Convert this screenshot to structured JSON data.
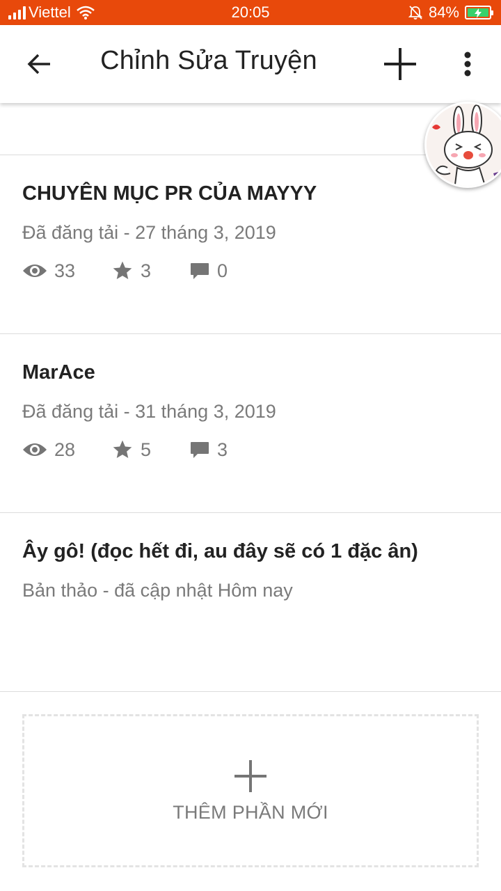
{
  "status_bar": {
    "carrier": "Viettel",
    "time": "20:05",
    "battery": "84%",
    "signal_icon": "signal-icon",
    "wifi_icon": "wifi-icon",
    "mute_icon": "bell-off-icon",
    "battery_icon": "battery-charging-icon"
  },
  "app_bar": {
    "title": "Chỉnh Sửa Truyện",
    "back_icon": "arrow-left-icon",
    "add_icon": "plus-icon",
    "more_icon": "more-vert-icon"
  },
  "parts": [
    {
      "title": "CHUYÊN MỤC PR CỦA MAYYY",
      "subtitle": "Đã đăng tải - 27 tháng 3, 2019",
      "views": "33",
      "votes": "3",
      "comments": "0"
    },
    {
      "title": "MarAce",
      "subtitle": "Đã đăng tải - 31 tháng 3, 2019",
      "views": "28",
      "votes": "5",
      "comments": "3"
    },
    {
      "title": "Ây gô! (đọc hết đi, au đây sẽ có 1 đặc ân)",
      "subtitle": "Bản thảo - đã cập nhật Hôm nay"
    }
  ],
  "add_part": {
    "label": "THÊM PHẦN MỚI",
    "icon": "plus-icon"
  },
  "colors": {
    "status_bar": "#e8490b",
    "text_primary": "#222222",
    "text_secondary": "#7a7a7a",
    "icon_gray": "#757575",
    "battery_fill": "#37d16b"
  }
}
